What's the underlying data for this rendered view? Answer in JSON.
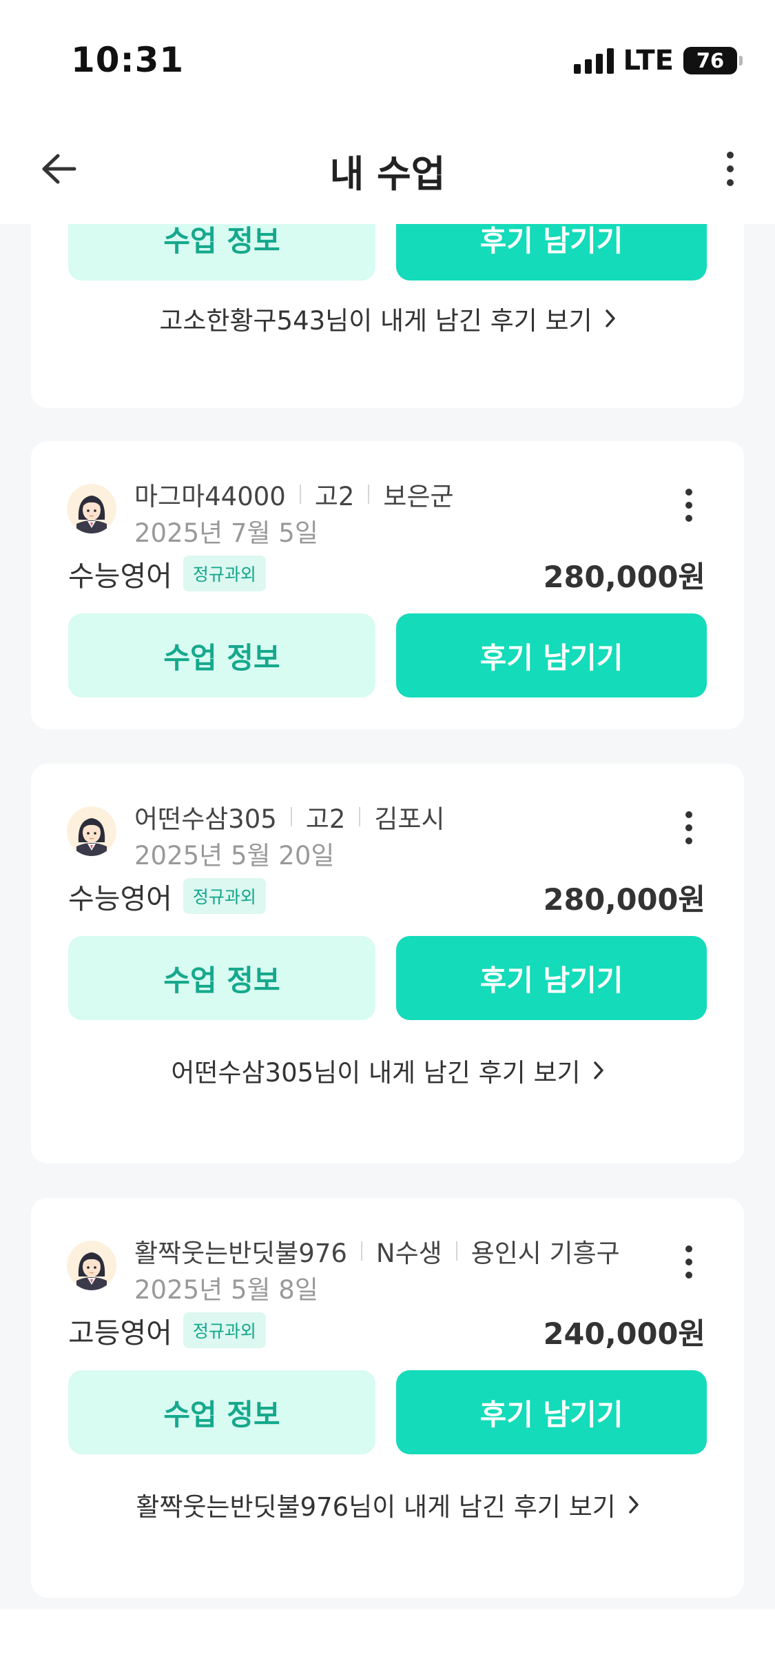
{
  "status_bar": {
    "time": "10:31",
    "network": "LTE",
    "battery": "76"
  },
  "header": {
    "title": "내 수업"
  },
  "top_card": {
    "info_label": "수업 정보",
    "review_label": "후기 남기기",
    "review_link": "고소한황구543님이 내게 남긴 후기 보기"
  },
  "lessons": [
    {
      "nickname": "마그마44000",
      "grade": "고2",
      "region": "보은군",
      "date": "2025년 7월 5일",
      "subject": "수능영어",
      "tag": "정규과외",
      "price": "280,000원",
      "info_label": "수업 정보",
      "review_label": "후기 남기기"
    },
    {
      "nickname": "어떤수삼305",
      "grade": "고2",
      "region": "김포시",
      "date": "2025년 5월 20일",
      "subject": "수능영어",
      "tag": "정규과외",
      "price": "280,000원",
      "info_label": "수업 정보",
      "review_label": "후기 남기기",
      "review_link": "어떤수삼305님이 내게 남긴 후기 보기"
    },
    {
      "nickname": "활짝웃는반딧불976",
      "grade": "N수생",
      "region": "용인시 기흥구",
      "date": "2025년 5월 8일",
      "subject": "고등영어",
      "tag": "정규과외",
      "price": "240,000원",
      "info_label": "수업 정보",
      "review_label": "후기 남기기",
      "review_link": "활짝웃는반딧불976님이 내게 남긴 후기 보기"
    }
  ],
  "colors": {
    "accent": "#14dbb9",
    "accent_light": "#d8fbf2",
    "accent_text": "#16a88c",
    "background": "#f6f7f8"
  },
  "icons": {
    "back": "arrow-left-icon",
    "more": "more-vertical-icon",
    "chevron": "chevron-right-icon",
    "avatar": "student-avatar-icon"
  }
}
